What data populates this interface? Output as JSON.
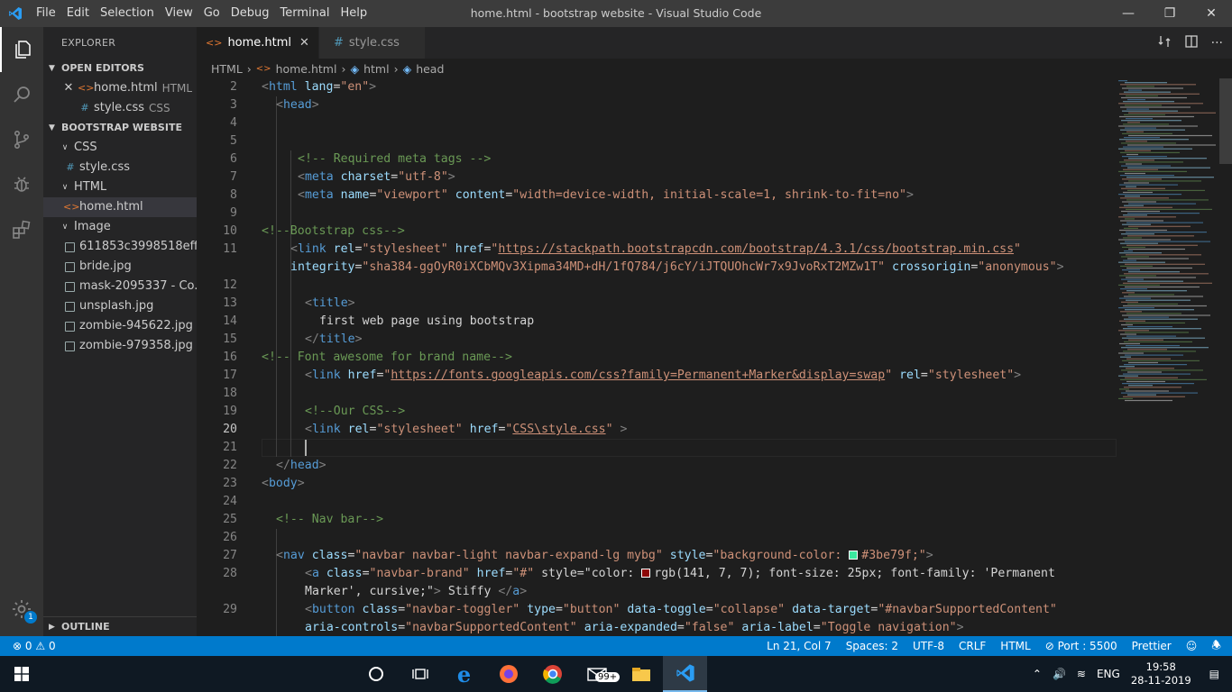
{
  "titlebar": {
    "menus": [
      "File",
      "Edit",
      "Selection",
      "View",
      "Go",
      "Debug",
      "Terminal",
      "Help"
    ],
    "window_title": "home.html - bootstrap website - Visual Studio Code",
    "logo_icon": "vscode-logo-icon",
    "accent": "#0098ff"
  },
  "activity": {
    "icons": [
      "files-icon",
      "search-icon",
      "source-control-icon",
      "debug-icon",
      "extensions-icon",
      "gear-icon"
    ],
    "badge": "1"
  },
  "sidebar": {
    "title": "EXPLORER",
    "open_editors_title": "OPEN EDITORS",
    "open_editors": [
      {
        "name": "home.html",
        "lang": "HTML"
      },
      {
        "name": "style.css",
        "lang": "CSS"
      }
    ],
    "project_title": "BOOTSTRAP WEBSITE",
    "tree": {
      "css_folder": "CSS",
      "css_file": "style.css",
      "html_folder": "HTML",
      "html_file": "home.html",
      "image_folder": "Image",
      "images": [
        "611853c3998518eff...",
        "bride.jpg",
        "mask-2095337 - Co...",
        "unsplash.jpg",
        "zombie-945622.jpg",
        "zombie-979358.jpg"
      ]
    },
    "outline_title": "OUTLINE"
  },
  "tabs": [
    {
      "label": "home.html",
      "active": true
    },
    {
      "label": "style.css",
      "active": false
    }
  ],
  "breadcrumb": [
    "HTML",
    "home.html",
    "html",
    "head"
  ],
  "editor": {
    "line_numbers": [
      "2",
      "3",
      "4",
      "5",
      "6",
      "7",
      "8",
      "9",
      "10",
      "11",
      "",
      "12",
      "13",
      "14",
      "15",
      "16",
      "17",
      "18",
      "19",
      "20",
      "21",
      "22",
      "23",
      "24",
      "25",
      "26",
      "27",
      "28",
      "",
      "29",
      ""
    ],
    "lines": [
      "<html lang=\"en\">",
      "<head>",
      "",
      "",
      "<!-- Required meta tags -->",
      "<meta charset=\"utf-8\">",
      "<meta name=\"viewport\" content=\"width=device-width, initial-scale=1, shrink-to-fit=no\">",
      "",
      "<!--Bootstrap css-->",
      "<link rel=\"stylesheet\" href=\"https://stackpath.bootstrapcdn.com/bootstrap/4.3.1/css/bootstrap.min.css\"",
      "integrity=\"sha384-ggOyR0iXCbMQv3Xipma34MD+dH/1fQ784/j6cY/iJTQUOhcWr7x9JvoRxT2MZw1T\" crossorigin=\"anonymous\">",
      "",
      "<title>",
      "first web page using bootstrap",
      "</title>",
      "<!-- Font awesome for brand name-->",
      "<link href=\"https://fonts.googleapis.com/css?family=Permanent+Marker&display=swap\" rel=\"stylesheet\">",
      "",
      "<!--Our CSS-->",
      "<link rel=\"stylesheet\" href=\"CSS\\style.css\" >",
      "",
      "</head>",
      "<body>",
      "",
      "<!-- Nav bar-->",
      "",
      "<nav class=\"navbar navbar-light navbar-expand-lg mybg\" style=\"background-color: #3be79f;\">",
      "<a class=\"navbar-brand\" href=\"#\" style=\"color: rgb(141, 7, 7); font-size: 25px; font-family: 'Permanent",
      "Marker', cursive;\"> Stiffy </a>",
      "<button class=\"navbar-toggler\" type=\"button\" data-toggle=\"collapse\" data-target=\"#navbarSupportedContent\"",
      "aria-controls=\"navbarSupportedContent\" aria-expanded=\"false\" aria-label=\"Toggle navigation\">"
    ],
    "swatch_colors": [
      "#3be79f",
      "#8d0707"
    ]
  },
  "statusbar": {
    "errors": "0",
    "warnings": "0",
    "position": "Ln 21, Col 7",
    "spaces": "Spaces: 2",
    "encoding": "UTF-8",
    "eol": "CRLF",
    "language": "HTML",
    "port": "Port : 5500",
    "formatter": "Prettier",
    "bg": "#007acc"
  },
  "taskbar": {
    "time": "19:58",
    "date": "28-11-2019",
    "lang": "ENG",
    "mail_badge": "99+"
  }
}
